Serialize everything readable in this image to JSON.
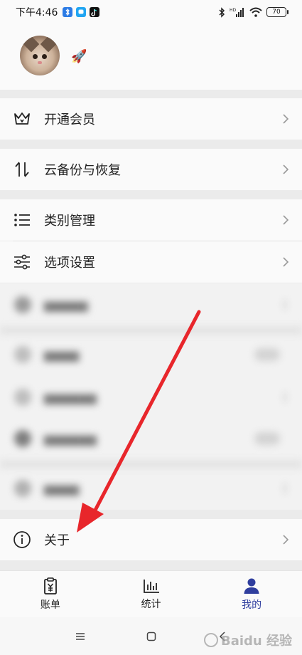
{
  "status_bar": {
    "time": "下午4:46",
    "signal_label": "HD",
    "battery": "70"
  },
  "menu": {
    "vip": "开通会员",
    "backup": "云备份与恢复",
    "category": "类别管理",
    "options": "选项设置",
    "about": "关于"
  },
  "tabs": {
    "bill": "账单",
    "stats": "统计",
    "mine": "我的"
  },
  "colors": {
    "accent": "#2f3e9e",
    "annotation_arrow": "#e8262b"
  },
  "watermark": "Baidu 经验"
}
